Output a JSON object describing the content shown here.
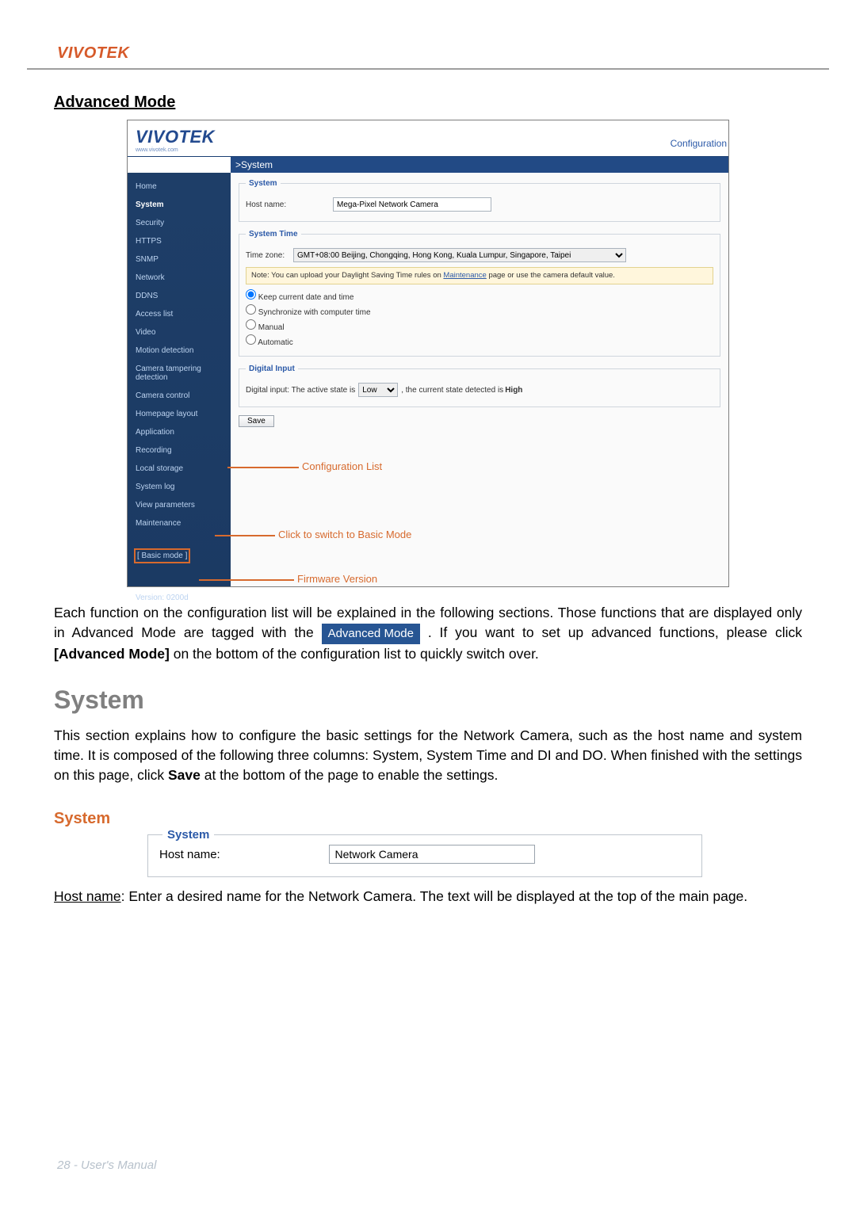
{
  "header": {
    "brand": "VIVOTEK"
  },
  "doc": {
    "adv_heading": "Advanced Mode",
    "para1_a": "Each function on the configuration list will be explained in the following sections. Those functions that are displayed only in Advanced Mode are tagged with the ",
    "inline_tag": "Advanced Mode",
    "para1_b": " . If you want to set up advanced functions, please click ",
    "para1_bold": "[Advanced Mode]",
    "para1_c": " on the bottom of the configuration list to quickly switch over.",
    "h1": "System",
    "para2_a": "This section explains how to configure the basic settings for the Network Camera, such as the host name and system time. It is composed of the following three columns: System, System Time and DI and DO. When finished with the settings on this page, click ",
    "para2_bold": "Save",
    "para2_b": " at the bottom of the page to enable the settings.",
    "h2": "System",
    "hostname_label": "Host name",
    "hostname_desc": ": Enter a desired name for the Network Camera. The text will be displayed at the top of the main page."
  },
  "shot": {
    "logo_text": "VIVOTEK",
    "logo_url": "www.vivotek.com",
    "config_link": "Configuration",
    "crumb": ">System",
    "sidebar": {
      "items": [
        {
          "label": "Home"
        },
        {
          "label": "System"
        },
        {
          "label": "Security"
        },
        {
          "label": "HTTPS"
        },
        {
          "label": "SNMP"
        },
        {
          "label": "Network"
        },
        {
          "label": "DDNS"
        },
        {
          "label": "Access list"
        },
        {
          "label": "Video"
        },
        {
          "label": "Motion detection"
        },
        {
          "label": "Camera tampering detection"
        },
        {
          "label": "Camera control"
        },
        {
          "label": "Homepage layout"
        },
        {
          "label": "Application"
        },
        {
          "label": "Recording"
        },
        {
          "label": "Local storage"
        },
        {
          "label": "System log"
        },
        {
          "label": "View parameters"
        },
        {
          "label": "Maintenance"
        }
      ],
      "basic_mode": "[ Basic mode ]",
      "version": "Version: 0200d"
    },
    "pane": {
      "system_legend": "System",
      "hostname_label": "Host name:",
      "hostname_value": "Mega-Pixel Network Camera",
      "systime_legend": "System Time",
      "tz_label": "Time zone:",
      "tz_value": "GMT+08:00 Beijing, Chongqing, Hong Kong, Kuala Lumpur, Singapore, Taipei",
      "note_a": "Note: You can upload your Daylight Saving Time rules on ",
      "note_link": "Maintenance",
      "note_b": " page or use the camera default value.",
      "radio_keep": "Keep current date and time",
      "radio_sync": "Synchronize with computer time",
      "radio_manual": "Manual",
      "radio_auto": "Automatic",
      "di_legend": "Digital Input",
      "di_a": "Digital input: The active state is ",
      "di_sel": "Low",
      "di_b": " , the current state detected is ",
      "di_bold": "High",
      "save": "Save"
    },
    "callouts": {
      "config_list": "Configuration List",
      "basic": "Click to switch to Basic Mode",
      "fw": "Firmware Version"
    }
  },
  "sys_figure": {
    "legend": "System",
    "hostname_label": "Host name:",
    "hostname_value": "Network Camera"
  },
  "footer": {
    "text": "28 - User's Manual"
  }
}
